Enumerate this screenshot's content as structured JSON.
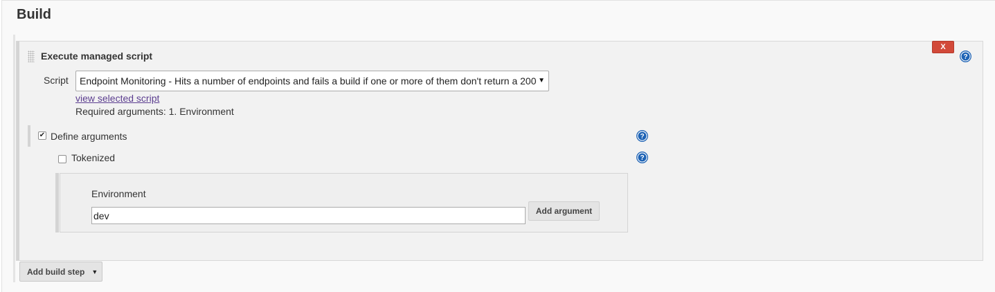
{
  "section": {
    "title": "Build"
  },
  "step": {
    "title": "Execute managed script",
    "delete_label": "X",
    "script_label": "Script",
    "script_selected": "Endpoint Monitoring - Hits a number of endpoints and fails a build if one or more of them don't return a 200",
    "view_link": "view selected script",
    "required_args": "Required arguments: 1. Environment",
    "define_arguments": {
      "label": "Define arguments",
      "checked": true
    },
    "tokenized": {
      "label": "Tokenized",
      "checked": false
    },
    "argument": {
      "label": "Environment",
      "value": "dev",
      "add_label": "Add argument"
    }
  },
  "add_build_step": {
    "label": "Add build step"
  },
  "colors": {
    "delete_red": "#d24939",
    "help_blue": "#1e63b5",
    "link_purple": "#5b3d8f"
  }
}
